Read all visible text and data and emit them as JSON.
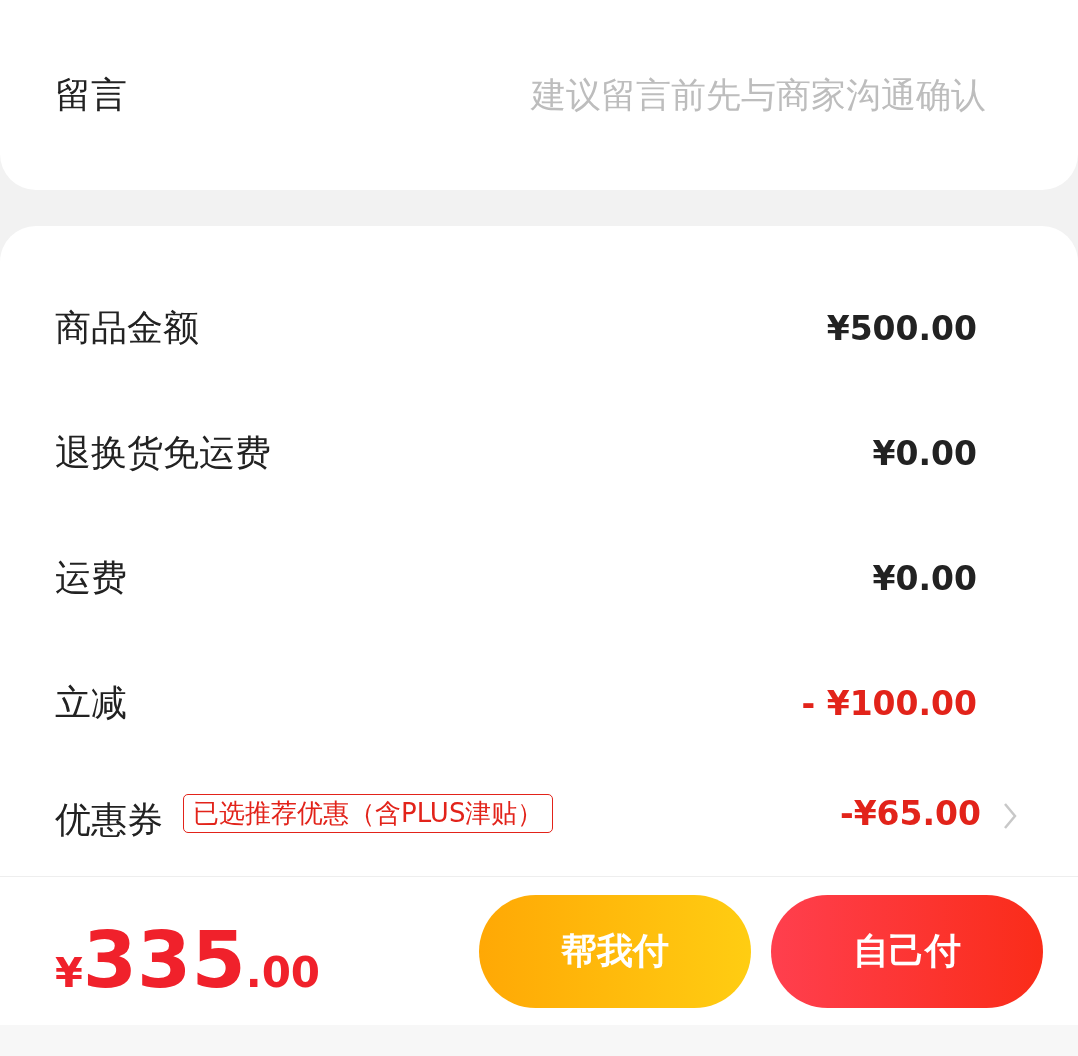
{
  "message": {
    "label": "留言",
    "placeholder": "建议留言前先与商家沟通确认"
  },
  "summary": [
    {
      "label": "商品金额",
      "value": "¥500.00",
      "kind": "normal"
    },
    {
      "label": "退换货免运费",
      "value": "¥0.00",
      "kind": "normal"
    },
    {
      "label": "运费",
      "value": "¥0.00",
      "kind": "normal"
    },
    {
      "label": "立减",
      "value": "- ¥100.00",
      "kind": "discount"
    },
    {
      "label": "优惠券",
      "value": "-¥65.00",
      "kind": "coupon",
      "tag": "已选推荐优惠（含PLUS津贴）"
    }
  ],
  "footer": {
    "currency": "¥",
    "integer": "335",
    "decimal": ".00",
    "buttons": [
      {
        "label": "帮我付",
        "kind": "friend"
      },
      {
        "label": "自己付",
        "kind": "self"
      }
    ]
  }
}
